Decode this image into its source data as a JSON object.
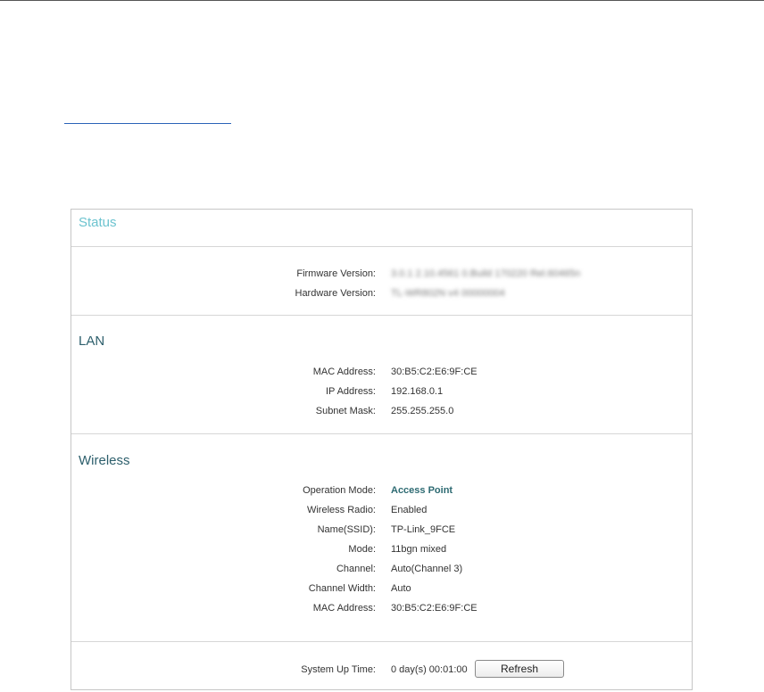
{
  "status_panel": {
    "title": "Status",
    "system": {
      "firmware_label": "Firmware Version:",
      "firmware_value": "3.0.1 2.10.4561 0.Build 170220 Rel.60465n",
      "hardware_label": "Hardware Version:",
      "hardware_value": "TL-WR802N v4 00000004"
    },
    "lan": {
      "title": "LAN",
      "rows": [
        {
          "label": "MAC Address:",
          "value": "30:B5:C2:E6:9F:CE"
        },
        {
          "label": "IP Address:",
          "value": "192.168.0.1"
        },
        {
          "label": "Subnet Mask:",
          "value": "255.255.255.0"
        }
      ]
    },
    "wireless": {
      "title": "Wireless",
      "rows": [
        {
          "label": "Operation Mode:",
          "value": "Access Point"
        },
        {
          "label": "Wireless Radio:",
          "value": "Enabled"
        },
        {
          "label": "Name(SSID):",
          "value": "TP-Link_9FCE"
        },
        {
          "label": "Mode:",
          "value": "11bgn mixed"
        },
        {
          "label": "Channel:",
          "value": "Auto(Channel 3)"
        },
        {
          "label": "Channel Width:",
          "value": "Auto"
        },
        {
          "label": "MAC Address:",
          "value": "30:B5:C2:E6:9F:CE"
        }
      ]
    },
    "uptime": {
      "label": "System Up Time:",
      "value": "0 day(s) 00:01:00",
      "refresh_label": "Refresh"
    }
  },
  "colors": {
    "panel_title": "#6cc3cf",
    "section_title": "#2d5f6c",
    "highlight_value": "#2d6a72",
    "link_underline": "#2a63b8"
  }
}
